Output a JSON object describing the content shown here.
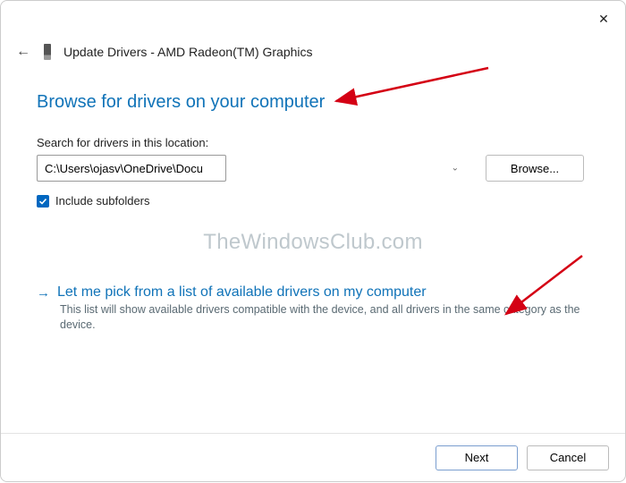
{
  "titlebar": {
    "close_glyph": "✕"
  },
  "header": {
    "back_glyph": "←",
    "title": "Update Drivers - AMD Radeon(TM) Graphics"
  },
  "page": {
    "heading": "Browse for drivers on your computer"
  },
  "search": {
    "label": "Search for drivers in this location:",
    "path_value": "C:\\Users\\ojasv\\OneDrive\\Documents",
    "dropdown_glyph": "⌄",
    "browse_label": "Browse..."
  },
  "include_subfolders": {
    "label": "Include subfolders",
    "checked": true
  },
  "watermark": "TheWindowsClub.com",
  "pick_option": {
    "arrow_glyph": "→",
    "title": "Let me pick from a list of available drivers on my computer",
    "description": "This list will show available drivers compatible with the device, and all drivers in the same category as the device."
  },
  "footer": {
    "next_label": "Next",
    "cancel_label": "Cancel"
  }
}
